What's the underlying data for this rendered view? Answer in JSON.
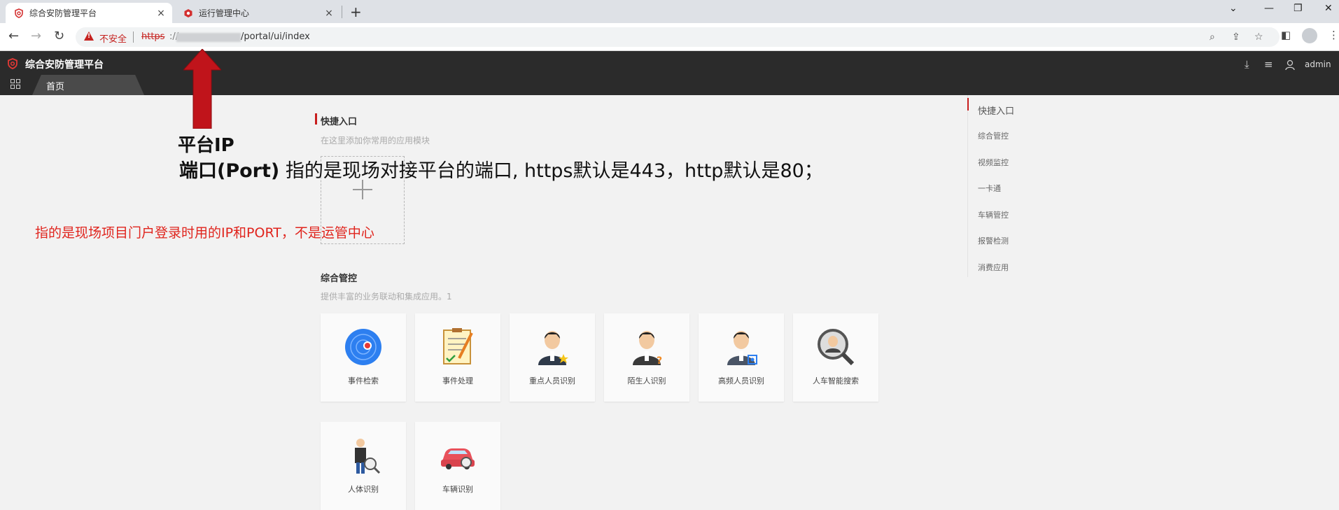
{
  "browser": {
    "tabs": [
      {
        "label": "综合安防管理平台",
        "close": "×"
      },
      {
        "label": "运行管理中心",
        "close": "×"
      }
    ],
    "new_tab": "+",
    "window_controls": {
      "minimize": "—",
      "restore": "❐",
      "close": "✕",
      "menu": "⌄"
    },
    "address": {
      "not_secure": "不安全",
      "scheme": "https",
      "separator": "://",
      "path": "/portal/ui/index"
    },
    "nav": {
      "back": "←",
      "forward": "→",
      "reload": "↻"
    },
    "icons": [
      "zoom-icon",
      "share-icon",
      "star-icon",
      "sidepanel-icon",
      "profile-icon",
      "kebab-menu-icon"
    ]
  },
  "app": {
    "title": "综合安防管理平台",
    "user": "admin",
    "home_tab": "首页",
    "accent_color": "#c81e1e",
    "header_bg": "#2b2b2b"
  },
  "quick_entry": {
    "title": "快捷入口",
    "desc": "在这里添加你常用的应用模块"
  },
  "integrated": {
    "title": "综合管控",
    "desc": "提供丰富的业务联动和集成应用。1",
    "apps": [
      {
        "label": "事件检索"
      },
      {
        "label": "事件处理"
      },
      {
        "label": "重点人员识别"
      },
      {
        "label": "陌生人识别"
      },
      {
        "label": "高频人员识别"
      },
      {
        "label": "人车智能搜索"
      },
      {
        "label": "人体识别"
      },
      {
        "label": "车辆识别"
      }
    ]
  },
  "right_nav": {
    "items": [
      {
        "label": "快捷入口"
      },
      {
        "label": "综合管控"
      },
      {
        "label": "视频监控"
      },
      {
        "label": "一卡通"
      },
      {
        "label": "车辆管控"
      },
      {
        "label": "报警检测"
      },
      {
        "label": "消费应用"
      }
    ]
  },
  "annotations": {
    "ip": "平台IP",
    "port_bold": "端口(Port)",
    "port_text": " 指的是现场对接平台的端口, https默认是443，http默认是80；",
    "red_note": "指的是现场项目门户登录时用的IP和PORT，不是运管中心"
  }
}
